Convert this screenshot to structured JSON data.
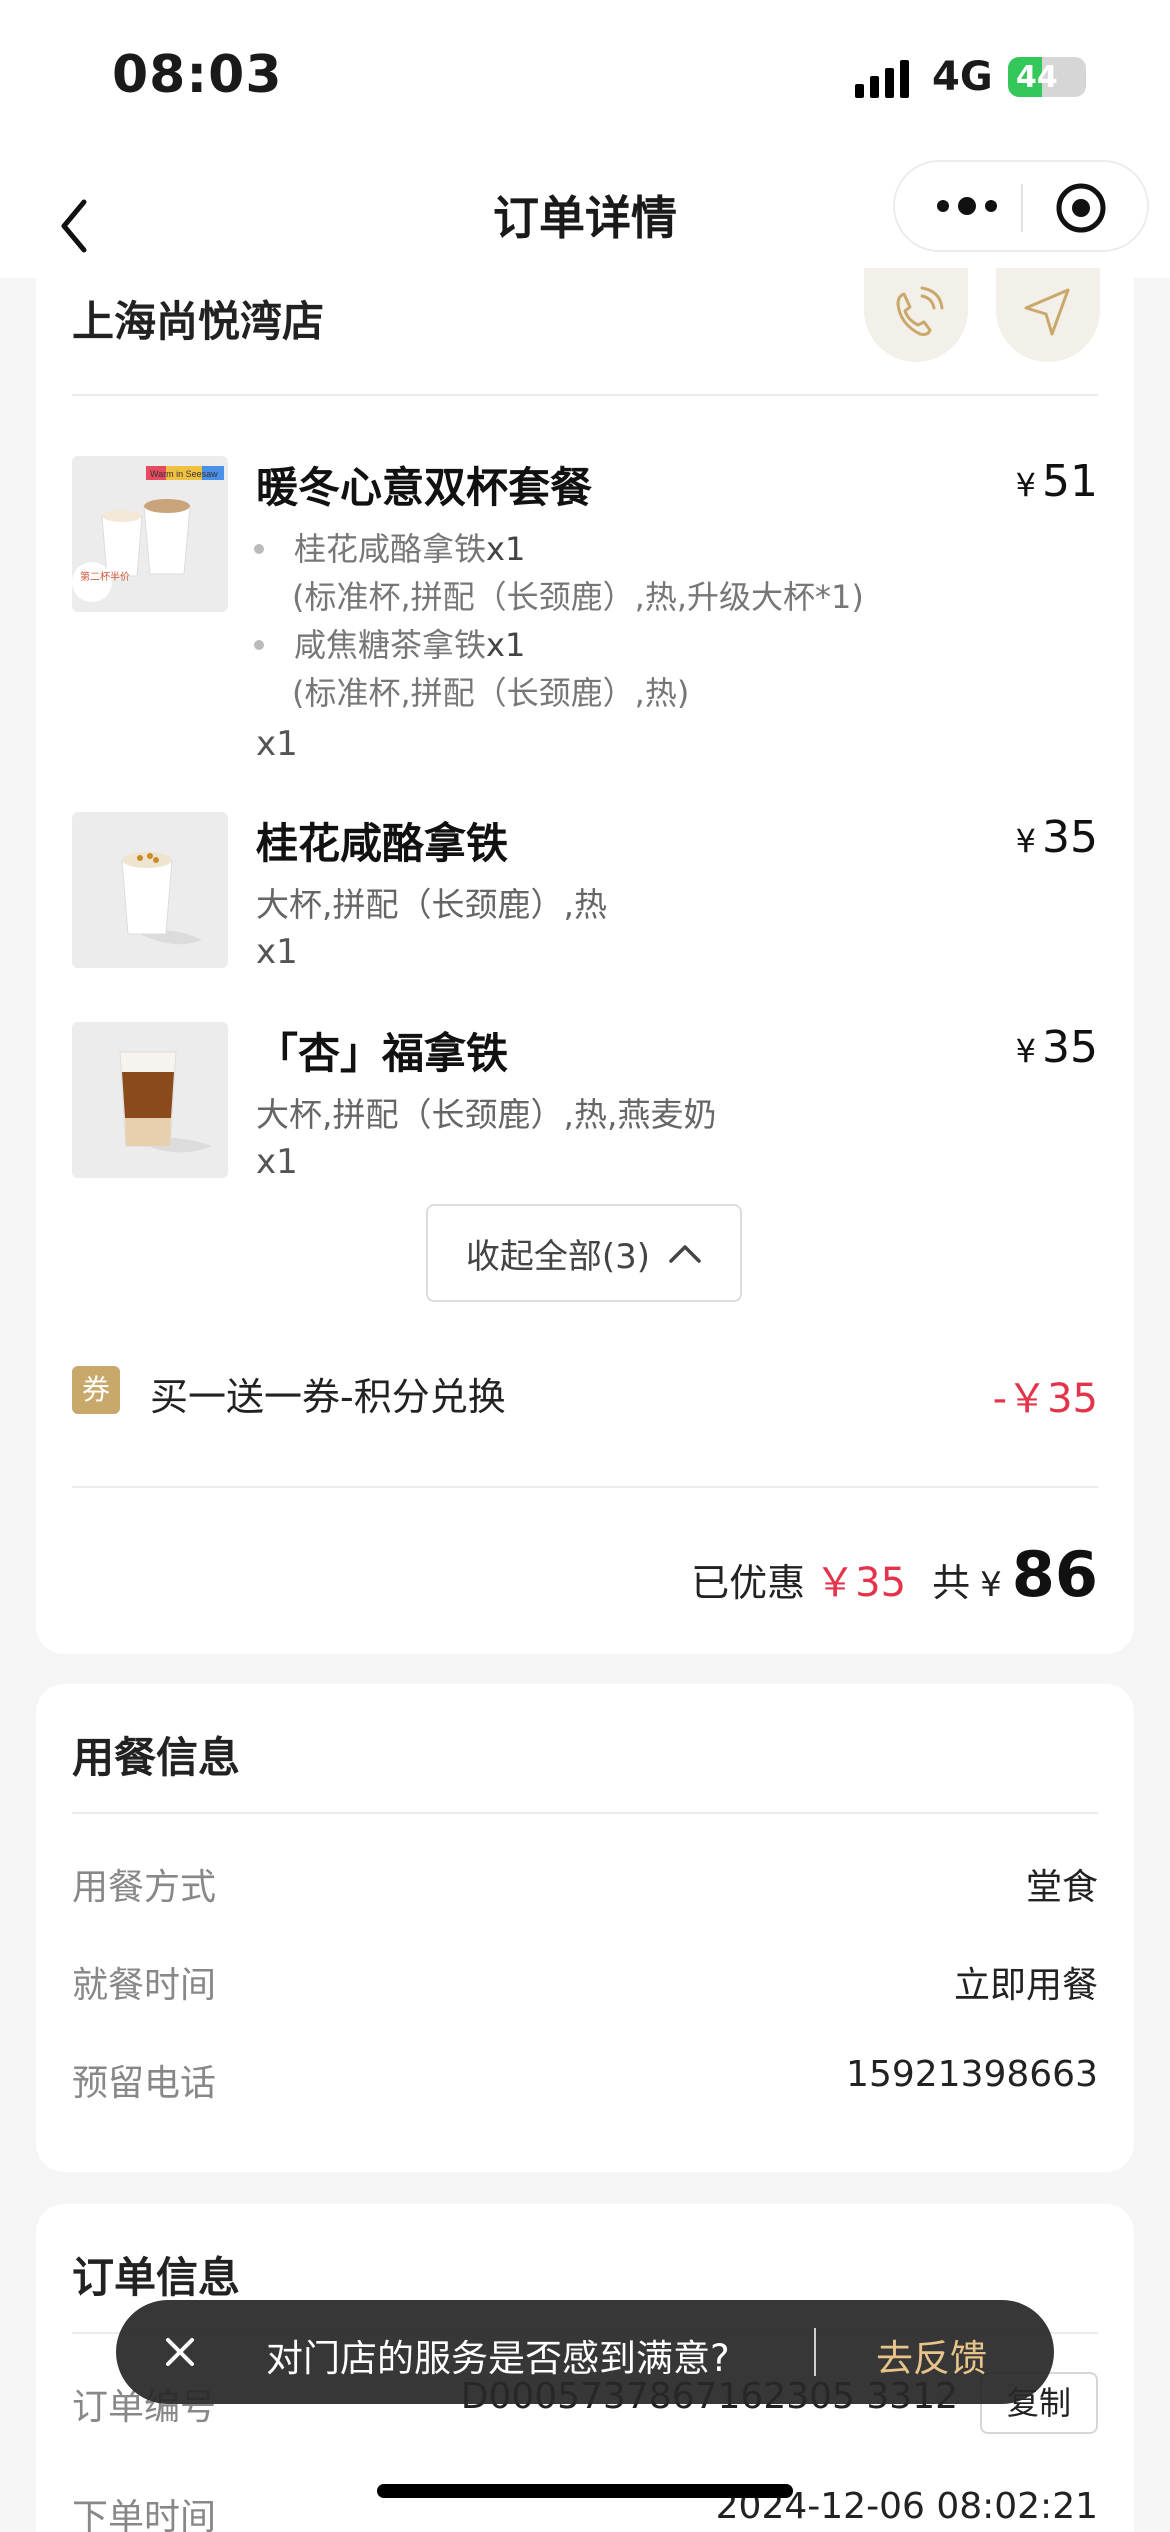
{
  "status": {
    "time": "08:03",
    "network": "4G",
    "battery": "44",
    "battery_level": 0.44
  },
  "nav": {
    "title": "订单详情"
  },
  "store": {
    "name": "上海尚悦湾店"
  },
  "products": [
    {
      "name": "暖冬心意双杯套餐",
      "price": "51",
      "badge": "第二杯半价",
      "banner": "Warm in Seesaw",
      "sub_items": [
        {
          "name": "桂花咸酪拿铁",
          "qty": "x1",
          "options": "(标准杯,拼配（长颈鹿）,热,升级大杯*1)"
        },
        {
          "name": "咸焦糖茶拿铁",
          "qty": "x1",
          "options": "(标准杯,拼配（长颈鹿）,热)"
        }
      ],
      "qty": "x1"
    },
    {
      "name": "桂花咸酪拿铁",
      "price": "35",
      "options": "大杯,拼配（长颈鹿）,热",
      "qty": "x1"
    },
    {
      "name": "「杏」福拿铁",
      "price": "35",
      "options": "大杯,拼配（长颈鹿）,热,燕麦奶",
      "qty": "x1"
    }
  ],
  "currency": "¥",
  "collapse_label": "收起全部(3)",
  "coupon": {
    "tag": "券",
    "text": "买一送一券-积分兑换",
    "value": "-￥35"
  },
  "totals": {
    "discount_label": "已优惠",
    "discount": "￥35",
    "total_label": "共",
    "yen": "¥",
    "total": "86"
  },
  "dining": {
    "title": "用餐信息",
    "rows": [
      {
        "label": "用餐方式",
        "value": "堂食"
      },
      {
        "label": "就餐时间",
        "value": "立即用餐"
      },
      {
        "label": "预留电话",
        "value": "15921398663"
      }
    ]
  },
  "order": {
    "title": "订单信息",
    "number_label": "订单编号",
    "number": "D0005737867162305 3312",
    "copy_label": "复制",
    "time_label": "下单时间",
    "time": "2024-12-06 08:02:21"
  },
  "toast": {
    "message": "对门店的服务是否感到满意?",
    "action": "去反馈"
  },
  "colors": {
    "accent_red": "#e5334b",
    "coupon_gold": "#c9a86c",
    "toast_action": "#e8c48a"
  }
}
